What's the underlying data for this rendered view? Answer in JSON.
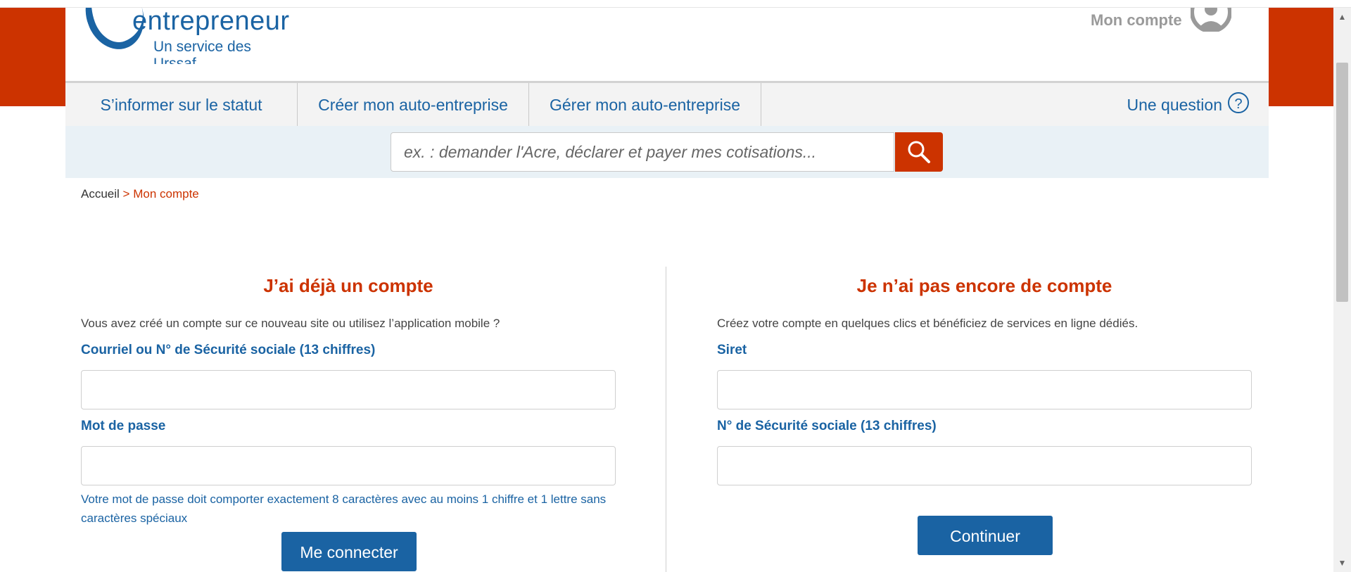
{
  "header": {
    "logo_text": "entrepreneur",
    "logo_subtitle": "Un service des Urssaf",
    "account_label": "Mon compte",
    "account_icon": "user-icon"
  },
  "nav": {
    "items": [
      {
        "label": "S’informer sur le statut"
      },
      {
        "label": "Créer mon auto-entreprise"
      },
      {
        "label": "Gérer mon auto-entreprise"
      }
    ],
    "question_label": "Une question",
    "question_icon": "help-circle-icon"
  },
  "search": {
    "placeholder": "ex. : demander l'Acre, déclarer et payer mes cotisations...",
    "value": "",
    "button_icon": "search-icon"
  },
  "breadcrumb": {
    "home": "Accueil",
    "separator": ">",
    "current": "Mon compte"
  },
  "login": {
    "title": "J’ai déjà un compte",
    "description": "Vous avez créé un compte sur ce nouveau site ou utilisez l’application mobile ?",
    "email_label": "Courriel ou N° de Sécurité sociale (13 chiffres)",
    "email_value": "",
    "password_label": "Mot de passe",
    "password_value": "",
    "password_hint": "Votre mot de passe doit comporter exactement 8 caractères avec au moins 1 chiffre et 1 lettre sans caractères spéciaux",
    "submit_label": "Me connecter"
  },
  "register": {
    "title": "Je n’ai pas encore de compte",
    "description": "Créez votre compte en quelques clics et bénéficiez de services en ligne dédiés.",
    "siret_label": "Siret",
    "siret_value": "",
    "ssn_label": "N° de Sécurité sociale (13 chiffres)",
    "ssn_value": "",
    "submit_label": "Continuer"
  },
  "colors": {
    "brand_red": "#cc3300",
    "brand_blue": "#1a63a3",
    "search_band": "#e9f1f6"
  }
}
